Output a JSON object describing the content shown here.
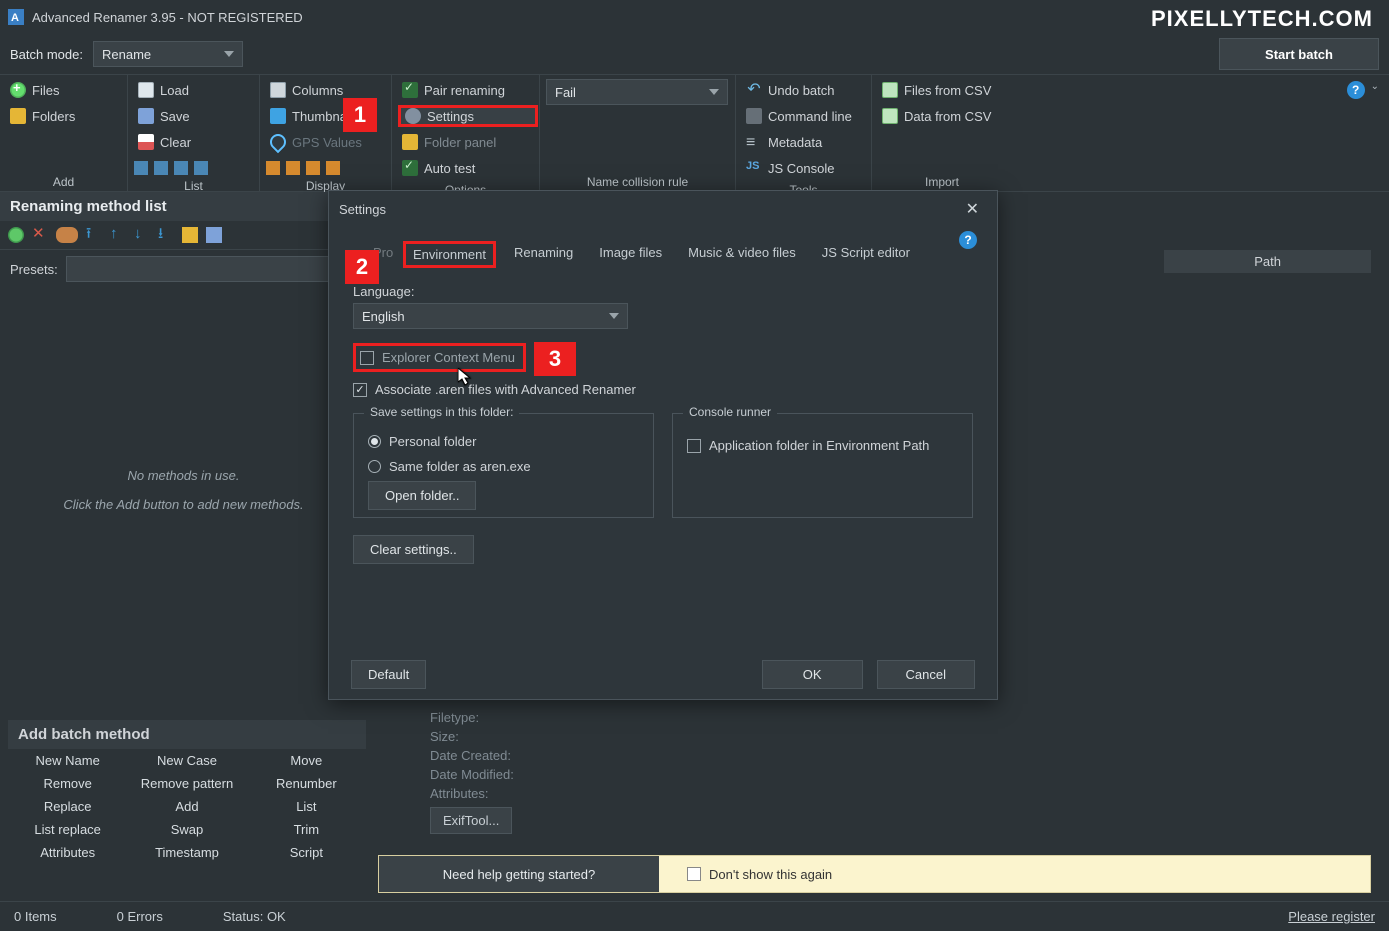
{
  "app": {
    "title": "Advanced Renamer 3.95 - NOT REGISTERED"
  },
  "watermark": "PIXELLYTECH.COM",
  "topstrip": {
    "batch_mode_label": "Batch mode:",
    "batch_mode_value": "Rename",
    "start_batch": "Start batch"
  },
  "ribbon": {
    "add": {
      "title": "Add",
      "files": "Files",
      "folders": "Folders"
    },
    "list": {
      "title": "List",
      "load": "Load",
      "save": "Save",
      "clear": "Clear"
    },
    "display": {
      "title": "Display",
      "columns": "Columns",
      "thumbnails": "Thumbna",
      "gps": "GPS Values"
    },
    "options": {
      "title": "Options",
      "pair": "Pair renaming",
      "settings": "Settings",
      "folder_panel": "Folder panel",
      "auto_test": "Auto test"
    },
    "collision": {
      "title": "Name collision rule",
      "value": "Fail"
    },
    "tools": {
      "title": "Tools",
      "undo": "Undo batch",
      "cmd": "Command line",
      "meta": "Metadata",
      "js": "JS Console"
    },
    "import": {
      "title": "Import",
      "files_csv": "Files from CSV",
      "data_csv": "Data from CSV"
    }
  },
  "methods": {
    "header": "Renaming method list",
    "presets_label": "Presets:",
    "none": "No methods in use.",
    "hint": "Click the Add button to add new methods."
  },
  "rightcol": {
    "path_header": "Path"
  },
  "callouts": {
    "c1": "1",
    "c2": "2",
    "c3": "3"
  },
  "settings": {
    "title": "Settings",
    "tabs": {
      "program": "Program",
      "environment": "Environment",
      "renaming": "Renaming",
      "image": "Image files",
      "media": "Music & video files",
      "js": "JS Script editor"
    },
    "language_label": "Language:",
    "language_value": "English",
    "explorer_ctx": "Explorer Context Menu",
    "assoc_aren": "Associate .aren files with Advanced Renamer",
    "save_group": "Save settings in this folder:",
    "personal": "Personal folder",
    "same_folder": "Same folder as aren.exe",
    "open_folder": "Open folder..",
    "console_group": "Console runner",
    "app_folder_path": "Application folder in Environment Path",
    "clear_settings": "Clear settings..",
    "default": "Default",
    "ok": "OK",
    "cancel": "Cancel"
  },
  "addbatch": {
    "header": "Add batch method",
    "rows": [
      [
        "New Name",
        "New Case",
        "Move"
      ],
      [
        "Remove",
        "Remove pattern",
        "Renumber"
      ],
      [
        "Replace",
        "Add",
        "List"
      ],
      [
        "List replace",
        "Swap",
        "Trim"
      ],
      [
        "Attributes",
        "Timestamp",
        "Script"
      ]
    ]
  },
  "fileinfo": {
    "filetype": "Filetype:",
    "size": "Size:",
    "created": "Date Created:",
    "modified": "Date Modified:",
    "attributes": "Attributes:",
    "exiftool": "ExifTool..."
  },
  "helpbar": {
    "msg": "Need help getting started?",
    "dont_show": "Don't show this again"
  },
  "status": {
    "items": "0 Items",
    "errors": "0 Errors",
    "status": "Status: OK",
    "register": "Please register"
  }
}
